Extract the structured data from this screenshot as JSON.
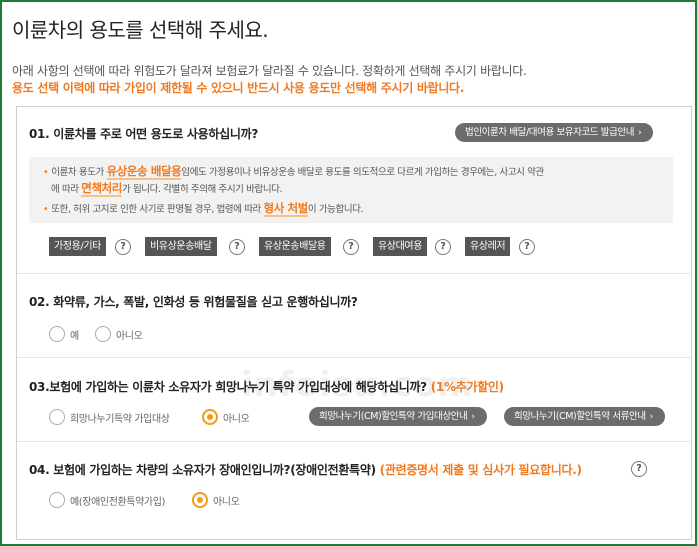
{
  "header": {
    "title": "이륜차의 용도를 선택해 주세요.",
    "desc_line1": "아래 사항의 선택에 따라 위험도가 달라져 보험료가 달라질 수 있습니다. 정확하게 선택해 주시기 바랍니다.",
    "desc_line2": "용도 선택 이력에 따라 가입이 제한될 수 있으니 반드시 사용 용도만 선택해 주시기 바랍니다."
  },
  "watermark": "infoisu.com",
  "q1": {
    "question": "01. 이륜차를 주로 어떤 용도로 사용하십니까?",
    "pill": "법인이륜차 배달/대여용 보유자코드 발급안내",
    "notice1_pre": "이륜차 용도가 ",
    "notice1_hl": "유상운송 배달용",
    "notice1_post": "임에도 가정용이나 비유상운송 배달로 용도를 의도적으로 다르게 가입하는 경우에는, 사고시 약관",
    "notice2_pre": "에 따라 ",
    "notice2_hl": "면책처리",
    "notice2_post": "가 됩니다. 각별히 주의해 주시기 바랍니다.",
    "notice3_pre": "또한, 허위 고지로 인한 사기로 판명될 경우, 법령에 따라 ",
    "notice3_hl": "형사 처벌",
    "notice3_post": "이 가능합니다.",
    "options": [
      "가정용/기타",
      "비유상운송배달",
      "유상운송배달용",
      "유상대여용",
      "유상레저"
    ]
  },
  "q2": {
    "question": "02. 화약류, 가스, 폭발, 인화성 등 위험물질을 싣고 운행하십니까?",
    "options": [
      "예",
      "아니오"
    ]
  },
  "q3": {
    "question": "03.보험에 가입하는 이륜차 소유자가 희망나누기 특약 가입대상에 해당하십니까?",
    "highlight": "(1%추가할인)",
    "options": [
      "희망나누기특약 가입대상",
      "아니오"
    ],
    "pill1": "희망나누기(CM)할인특약 가입대상안내",
    "pill2": "희망나누기(CM)할인특약 서류안내"
  },
  "q4": {
    "question": "04. 보험에 가입하는 차량의 소유자가 장애인입니까?(장애인전환특약)",
    "highlight": "(관련증명서 제출 및 심사가 필요합니다.)",
    "options": [
      "예(장애인전환특약가입)",
      "아니오"
    ]
  },
  "icons": {
    "help": "?",
    "chevron": "›"
  },
  "colors": {
    "border": "#1e7d33",
    "accent": "#f07a21",
    "radio_on": "#f39c12"
  }
}
